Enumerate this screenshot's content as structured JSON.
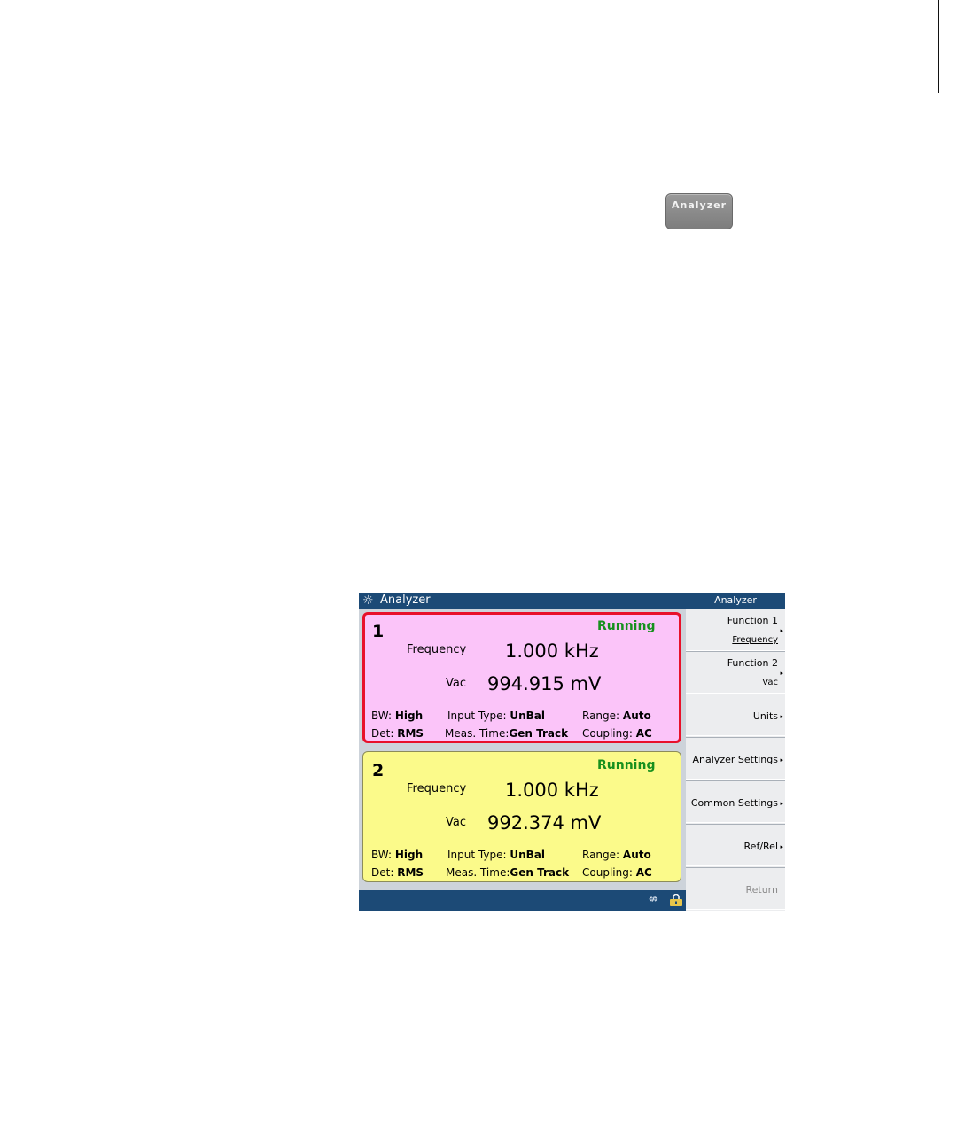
{
  "panel_key": {
    "label": "Analyzer"
  },
  "screen": {
    "title": "Analyzer",
    "channels": [
      {
        "number": "1",
        "status": "Running",
        "func1_label": "Frequency",
        "func1_value": "1.000 kHz",
        "func2_label": "Vac",
        "func2_value": "994.915 mV",
        "bw_label": "BW:",
        "bw_value": "High",
        "det_label": "Det:",
        "det_value": "RMS",
        "input_label": "Input Type:",
        "input_value": "UnBal",
        "meas_label": "Meas. Time:",
        "meas_value": "Gen Track",
        "range_label": "Range:",
        "range_value": "Auto",
        "coupling_label": "Coupling:",
        "coupling_value": "AC"
      },
      {
        "number": "2",
        "status": "Running",
        "func1_label": "Frequency",
        "func1_value": "1.000 kHz",
        "func2_label": "Vac",
        "func2_value": "992.374 mV",
        "bw_label": "BW:",
        "bw_value": "High",
        "det_label": "Det:",
        "det_value": "RMS",
        "input_label": "Input Type:",
        "input_value": "UnBal",
        "meas_label": "Meas. Time:",
        "meas_value": "Gen Track",
        "range_label": "Range:",
        "range_value": "Auto",
        "coupling_label": "Coupling:",
        "coupling_value": "AC"
      }
    ],
    "menu": {
      "title": "Analyzer",
      "keys": [
        {
          "label": "Function 1",
          "sub": "Frequency"
        },
        {
          "label": "Function 2",
          "sub": "Vac"
        },
        {
          "label": "Units"
        },
        {
          "label": "Analyzer Settings"
        },
        {
          "label": "Common Settings"
        },
        {
          "label": "Ref/Rel"
        },
        {
          "label": "Return"
        }
      ]
    },
    "status_icons": [
      "usb-icon",
      "lock-icon"
    ],
    "colors": {
      "title_bar": "#1c4a76",
      "channel1_bg": "#fbc4f9",
      "channel1_border": "#e8102a",
      "channel2_bg": "#fbfa8a",
      "running": "#16901d"
    }
  }
}
